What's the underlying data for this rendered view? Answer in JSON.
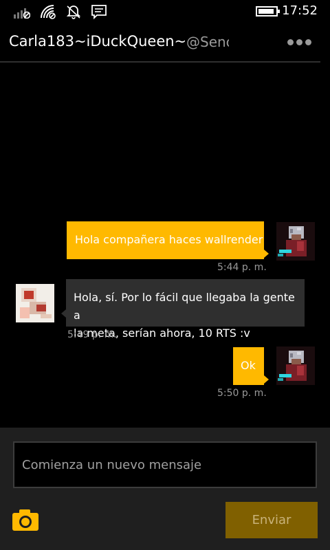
{
  "status_bar": {
    "time": "17:52",
    "icons": [
      "signal-icon",
      "wifi-icon",
      "quiet-hours-icon",
      "message-notification-icon",
      "battery-icon"
    ]
  },
  "header": {
    "contact_name": "Carla183~iDuckQueen~",
    "contact_handle": "@Senc",
    "more_icon": "more-options-icon"
  },
  "messages": [
    {
      "direction": "outgoing",
      "text": "Hola compañera haces wallrender",
      "time": "5:44 p. m."
    },
    {
      "direction": "incoming",
      "text_line1": "Hola, sí. Por lo fácil que llegaba la gente a",
      "text_line2": "la meta, serían ahora, 10 RTS :v",
      "time": "5:49 p. m."
    },
    {
      "direction": "outgoing",
      "text": "Ok",
      "time": "5:50 p. m."
    }
  ],
  "compose": {
    "placeholder": "Comienza un nuevo mensaje",
    "send_label": "Enviar",
    "camera_icon": "camera-icon"
  },
  "colors": {
    "accent": "#ffb900",
    "incoming_bubble": "#2f2f2f",
    "send_button_disabled": "#806000"
  }
}
